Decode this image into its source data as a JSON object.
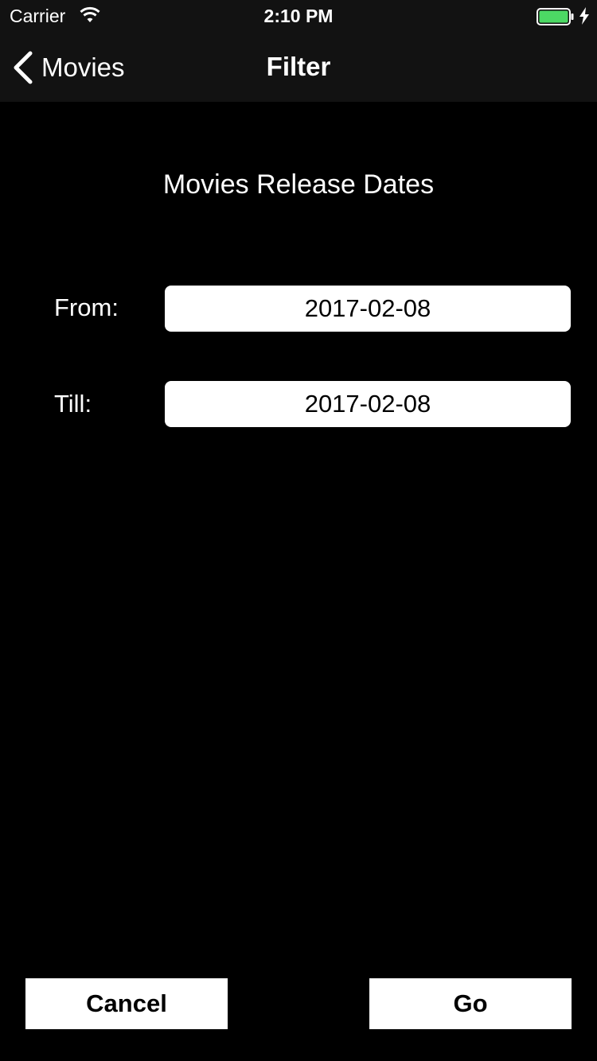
{
  "status_bar": {
    "carrier": "Carrier",
    "time": "2:10 PM",
    "wifi_icon": "wifi-icon",
    "battery_icon": "battery-full-icon",
    "charging_icon": "charging-bolt-icon",
    "battery_color": "#4cd964",
    "battery_level": 1.0
  },
  "nav": {
    "back_label": "Movies",
    "back_icon": "chevron-left-icon",
    "title": "Filter"
  },
  "content": {
    "section_title": "Movies Release Dates",
    "from_label": "From:",
    "from_value": "2017-02-08",
    "till_label": "Till:",
    "till_value": "2017-02-08"
  },
  "actions": {
    "cancel_label": "Cancel",
    "go_label": "Go"
  },
  "colors": {
    "background": "#000000",
    "bar_background": "#121212",
    "field_background": "#ffffff",
    "button_background": "#ffffff"
  }
}
